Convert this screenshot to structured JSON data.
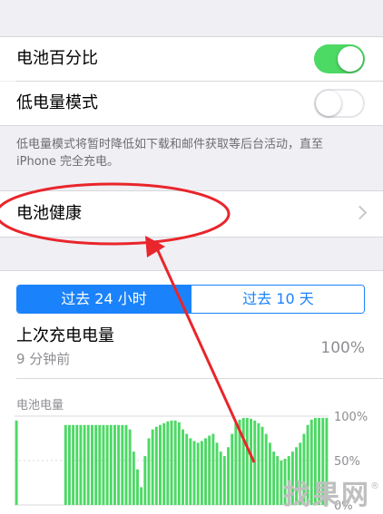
{
  "settings": {
    "battery_percentage_label": "电池百分比",
    "battery_percentage_on": true,
    "low_power_label": "低电量模式",
    "low_power_on": false,
    "low_power_note_line1": "低电量模式将暂时降低如下载和邮件获取等后台活动，直至",
    "low_power_note_line2": "iPhone 完全充电。",
    "battery_health_label": "电池健康"
  },
  "usage": {
    "segments": [
      "过去 24 小时",
      "过去 10 天"
    ],
    "selected_segment": 0,
    "last_charge_label": "上次充电电量",
    "last_charge_time": "9 分钟前",
    "last_charge_value": "100%"
  },
  "watermark": "找果网",
  "colors": {
    "toggle_on": "#4cd964",
    "accent_blue": "#1a82fb",
    "bar_green": "#4cd964",
    "annotation_red": "#e8262b"
  },
  "chart_data": {
    "type": "bar",
    "title": "电池电量",
    "ytick_labels": [
      "100%",
      "50%",
      "0%"
    ],
    "ylim": [
      0,
      100
    ],
    "values": [
      95,
      0,
      0,
      0,
      0,
      0,
      0,
      0,
      0,
      0,
      0,
      0,
      0,
      90,
      90,
      90,
      90,
      90,
      90,
      90,
      90,
      90,
      90,
      90,
      90,
      90,
      90,
      90,
      90,
      90,
      85,
      60,
      40,
      20,
      55,
      75,
      85,
      88,
      90,
      92,
      94,
      95,
      95,
      93,
      85,
      80,
      75,
      72,
      70,
      72,
      75,
      78,
      80,
      70,
      60,
      55,
      65,
      80,
      92,
      96,
      98,
      98,
      97,
      95,
      92,
      88,
      80,
      70,
      60,
      55,
      50,
      52,
      55,
      60,
      65,
      70,
      80,
      90,
      96,
      98,
      98,
      98,
      98
    ]
  }
}
